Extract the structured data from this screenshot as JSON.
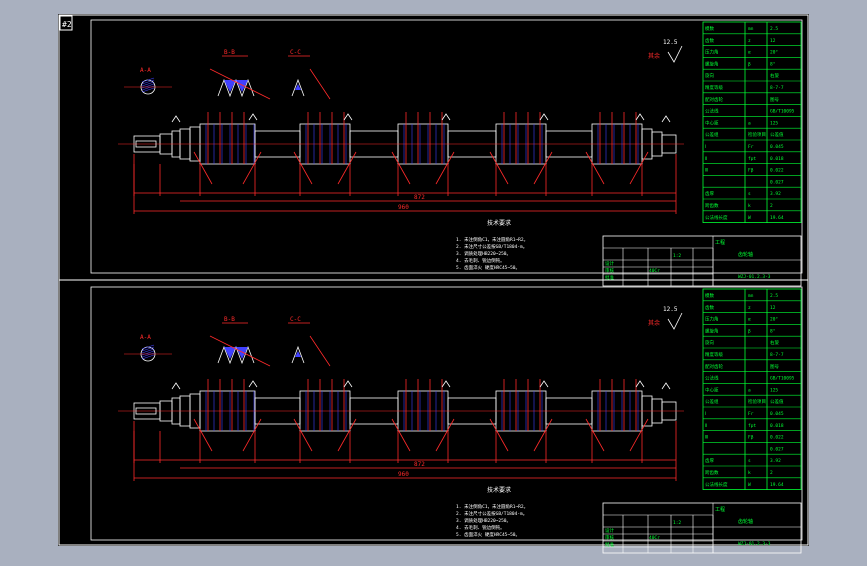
{
  "app": {
    "corner_label": "#2"
  },
  "colors": {
    "background": "#a9b0bf",
    "sheet": "#000000",
    "border": "#ffffff",
    "part": "#ffffff",
    "dimension": "#ff2a2a",
    "table": "#00ff33",
    "notes": "#ffffff",
    "gear_teeth": "#4040ff"
  },
  "sheets": [
    {
      "roughness_label": "12.5",
      "roughness_suffix": "其余",
      "section_a_label": "A-A",
      "section_b_label": "B-B",
      "section_c_label": "C-C",
      "title_above_notes": "技术要求",
      "notes": [
        "1. 未注倒角C1，未注圆角R1~R2。",
        "2. 未注尺寸公差按GB/T1804-m。",
        "3. 调质处理HB220~250。",
        "4. 去毛刺、锐边倒钝。",
        "5. 齿面淬火 硬度HRC45~50。"
      ],
      "overall_dim": "960",
      "sub_dim": "872",
      "param_table": [
        [
          "模数",
          "mn",
          "2.5"
        ],
        [
          "齿数",
          "z",
          "12"
        ],
        [
          "压力角",
          "α",
          "20°"
        ],
        [
          "螺旋角",
          "β",
          "8°"
        ],
        [
          "旋向",
          "",
          "右旋"
        ],
        [
          "精度等级",
          "",
          "8-7-7"
        ],
        [
          "配对齿轮",
          "",
          "图号"
        ],
        [
          "公法线",
          "",
          "GB/T10095"
        ],
        [
          "中心距",
          "a",
          "125"
        ],
        [
          "公差组",
          "检验项目",
          "公差值"
        ],
        [
          "Ⅰ",
          "Fr",
          "0.045"
        ],
        [
          "Ⅱ",
          "fpt",
          "0.018"
        ],
        [
          "Ⅲ",
          "Fβ",
          "0.022"
        ],
        [
          "",
          "",
          "0.027"
        ],
        [
          "齿厚",
          "s",
          "3.92"
        ],
        [
          "跨齿数",
          "k",
          "2"
        ],
        [
          "公法线长度",
          "W",
          "19.64"
        ]
      ],
      "title_block": {
        "part_name": "齿轮轴",
        "material": "40Cr",
        "scale": "1:2",
        "drawing_no": "WZJ-01.2.3-3",
        "designer_label": "设计",
        "checker_label": "审核",
        "approver_label": "批准",
        "company": "工程"
      }
    },
    {
      "roughness_label": "12.5",
      "roughness_suffix": "其余",
      "section_a_label": "A-A",
      "section_b_label": "B-B",
      "section_c_label": "C-C",
      "title_above_notes": "技术要求",
      "notes": [
        "1. 未注倒角C1，未注圆角R1~R2。",
        "2. 未注尺寸公差按GB/T1804-m。",
        "3. 调质处理HB220~250。",
        "4. 去毛刺、锐边倒钝。",
        "5. 齿面淬火 硬度HRC45~50。"
      ],
      "overall_dim": "960",
      "sub_dim": "872",
      "param_table": [
        [
          "模数",
          "mn",
          "2.5"
        ],
        [
          "齿数",
          "z",
          "12"
        ],
        [
          "压力角",
          "α",
          "20°"
        ],
        [
          "螺旋角",
          "β",
          "8°"
        ],
        [
          "旋向",
          "",
          "右旋"
        ],
        [
          "精度等级",
          "",
          "8-7-7"
        ],
        [
          "配对齿轮",
          "",
          "图号"
        ],
        [
          "公法线",
          "",
          "GB/T10095"
        ],
        [
          "中心距",
          "a",
          "125"
        ],
        [
          "公差组",
          "检验项目",
          "公差值"
        ],
        [
          "Ⅰ",
          "Fr",
          "0.045"
        ],
        [
          "Ⅱ",
          "fpt",
          "0.018"
        ],
        [
          "Ⅲ",
          "Fβ",
          "0.022"
        ],
        [
          "",
          "",
          "0.027"
        ],
        [
          "齿厚",
          "s",
          "3.92"
        ],
        [
          "跨齿数",
          "k",
          "2"
        ],
        [
          "公法线长度",
          "W",
          "19.64"
        ]
      ],
      "title_block": {
        "part_name": "齿轮轴",
        "material": "40Cr",
        "scale": "1:2",
        "drawing_no": "WZJ-01.2.3-3",
        "designer_label": "设计",
        "checker_label": "审核",
        "approver_label": "批准",
        "company": "工程"
      }
    }
  ]
}
